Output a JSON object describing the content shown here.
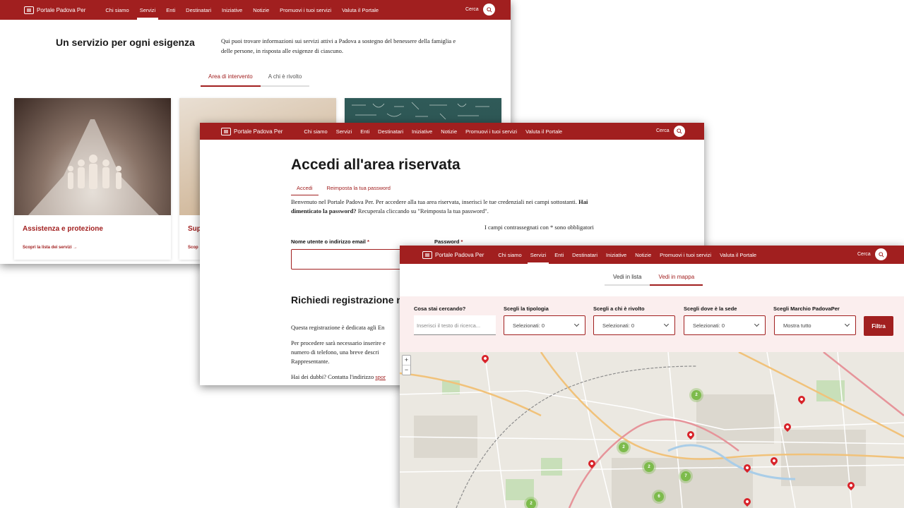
{
  "header": {
    "logo_text": "Portale Padova Per",
    "logo_sub": "Comune di Padova",
    "search_label": "Cerca",
    "menu": [
      "Chi siamo",
      "Servizi",
      "Enti",
      "Destinatari",
      "Iniziative",
      "Notizie",
      "Promuovi i tuoi servizi",
      "Valuta il Portale"
    ],
    "active_item": "Servizi"
  },
  "services_page": {
    "title": "Un servizio per ogni esigenza",
    "intro": "Qui puoi trovare informazioni sui servizi attivi a Padova a sostegno del benessere della famiglia e delle persone, in risposta alle esigenze di ciascuno.",
    "tabs": [
      "Area di intervento",
      "A chi è rivolto"
    ],
    "cards": [
      {
        "title": "Assistenza e protezione",
        "link": "Scopri la lista dei servizi →"
      },
      {
        "title": "Sup",
        "link": "Scop"
      }
    ]
  },
  "login_page": {
    "title": "Accedi all'area riservata",
    "tabs": [
      "Accedi",
      "Reimposta la tua password"
    ],
    "intro_plain": "Benvenuto nel Portale Padova Per. Per accedere alla tua area riservata, inserisci le tue credenziali nei campi sottostanti.",
    "intro_bold": "Hai dimenticato la password?",
    "intro_rest": "Recuperala cliccando su \"Reimposta la tua password\".",
    "required_note": "I campi contrassegnati con * sono obbligatori",
    "username_label": "Nome utente o indirizzo email",
    "password_label": "Password",
    "asterisk": "*",
    "register_title": "Richiedi registrazione n",
    "register_p1": "Questa registrazione è dedicata agli En",
    "register_p2": "Per procedere sarà necessario inserire e numero di telefono, una breve descri Rappresentante.",
    "doubts": "Hai dei dubbi? Contatta l'indirizzo",
    "doubts_link": "spor"
  },
  "map_page": {
    "tabs": [
      "Vedi in lista",
      "Vedi in mappa"
    ],
    "filters": {
      "search_label": "Cosa stai cercando?",
      "search_placeholder": "Inserisci il testo di ricerca...",
      "type_label": "Scegli la tipologia",
      "type_value": "Selezionati: 0",
      "target_label": "Scegli a chi è rivolto",
      "target_value": "Selezionati: 0",
      "place_label": "Scegli dove è la sede",
      "place_value": "Selezionati: 0",
      "brand_label": "Scegli Marchio PadovaPer",
      "brand_value": "Mostra tutto",
      "button": "Filtra"
    },
    "zoom_in": "+",
    "zoom_out": "−",
    "clusters": [
      "2",
      "2",
      "2",
      "7",
      "6",
      "2"
    ]
  },
  "colors": {
    "brand": "#a11f1f",
    "filter_bg": "#fbeeee",
    "pin": "#d8232a",
    "cluster": "#7dbb4c"
  }
}
